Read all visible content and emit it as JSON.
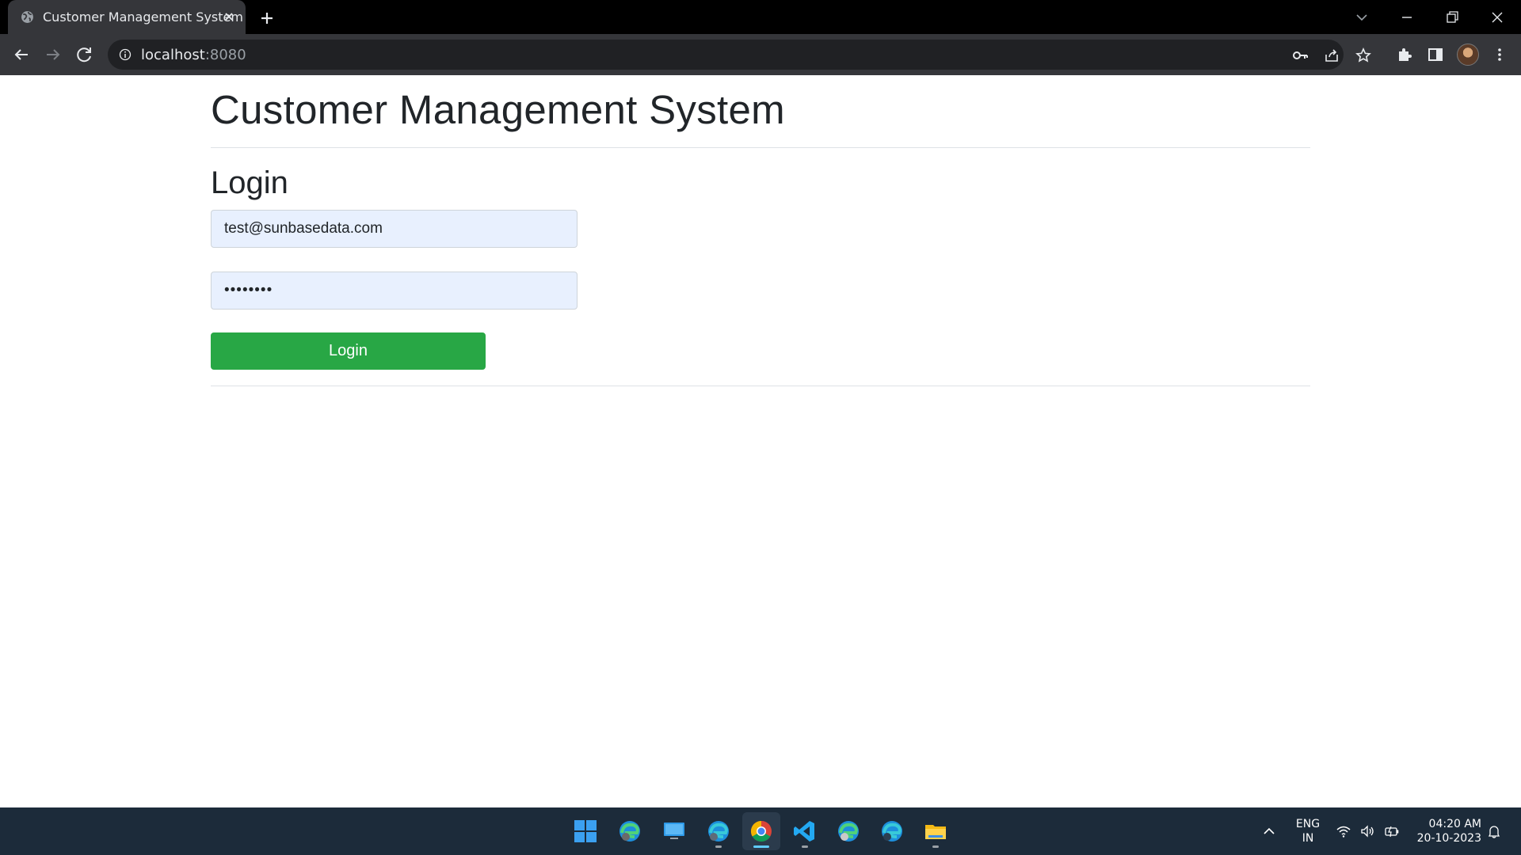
{
  "browser": {
    "tab": {
      "title": "Customer Management System",
      "favicon": "globe-icon"
    },
    "address": {
      "host": "localhost",
      "port": ":8080"
    }
  },
  "page": {
    "title": "Customer Management System",
    "login_heading": "Login",
    "email_value": "test@sunbasedata.com",
    "password_value": "••••••••",
    "login_button": "Login",
    "accent_color": "#28a745",
    "field_bg": "#e8f0fe"
  },
  "taskbar": {
    "apps": [
      "windows-start-icon",
      "edge-beta-icon",
      "desktop-icon",
      "edge-dev-icon",
      "chrome-icon",
      "vscode-icon",
      "edge-canary-icon",
      "edge-icon",
      "file-explorer-icon"
    ],
    "active_app": "chrome-icon",
    "lang_line1": "ENG",
    "lang_line2": "IN",
    "time": "04:20 AM",
    "date": "20-10-2023"
  }
}
